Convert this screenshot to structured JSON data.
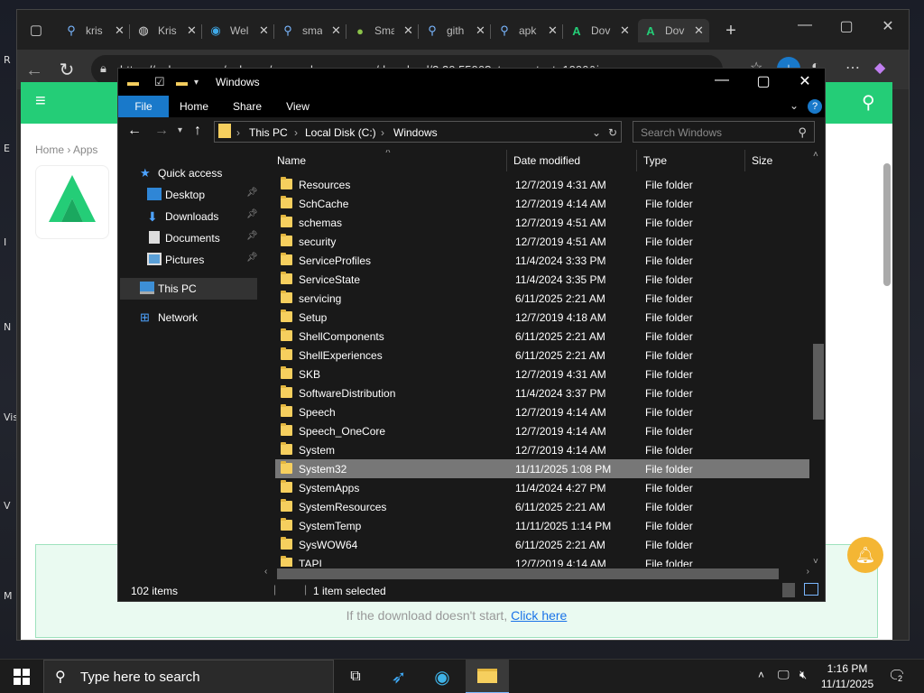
{
  "browser": {
    "tabs": [
      {
        "label": "kris",
        "icon": "search-icon"
      },
      {
        "label": "Kris",
        "icon": "globe-icon"
      },
      {
        "label": "Wel",
        "icon": "edge-icon"
      },
      {
        "label": "sma",
        "icon": "search-icon"
      },
      {
        "label": "Sma",
        "icon": "android-icon"
      },
      {
        "label": "gith",
        "icon": "search-icon"
      },
      {
        "label": "apk",
        "icon": "search-icon"
      },
      {
        "label": "Dov",
        "icon": "apkpure-icon"
      },
      {
        "label": "Dov",
        "icon": "apkpure-icon"
      }
    ],
    "url": "https://apkpure.com/apkpure/com.apkpure.aegon/download/3.20.5506?utm_content=1006&icn..."
  },
  "page": {
    "breadcrumb_home": "Home",
    "breadcrumb_apps": "Apps",
    "download_hint": "If the download doesn't start,",
    "download_link": "Click here"
  },
  "explorer": {
    "title": "Windows",
    "ribbon": {
      "file": "File",
      "home": "Home",
      "share": "Share",
      "view": "View"
    },
    "address": {
      "this_pc": "This PC",
      "local_disk": "Local Disk (C:)",
      "windows": "Windows"
    },
    "search_placeholder": "Search Windows",
    "nav": {
      "quick_access": "Quick access",
      "desktop": "Desktop",
      "downloads": "Downloads",
      "documents": "Documents",
      "pictures": "Pictures",
      "this_pc": "This PC",
      "network": "Network"
    },
    "columns": {
      "name": "Name",
      "date": "Date modified",
      "type": "Type",
      "size": "Size"
    },
    "files": [
      {
        "name": "Resources",
        "date": "12/7/2019 4:31 AM",
        "type": "File folder"
      },
      {
        "name": "SchCache",
        "date": "12/7/2019 4:14 AM",
        "type": "File folder"
      },
      {
        "name": "schemas",
        "date": "12/7/2019 4:51 AM",
        "type": "File folder"
      },
      {
        "name": "security",
        "date": "12/7/2019 4:51 AM",
        "type": "File folder"
      },
      {
        "name": "ServiceProfiles",
        "date": "11/4/2024 3:33 PM",
        "type": "File folder"
      },
      {
        "name": "ServiceState",
        "date": "11/4/2024 3:35 PM",
        "type": "File folder"
      },
      {
        "name": "servicing",
        "date": "6/11/2025 2:21 AM",
        "type": "File folder"
      },
      {
        "name": "Setup",
        "date": "12/7/2019 4:18 AM",
        "type": "File folder"
      },
      {
        "name": "ShellComponents",
        "date": "6/11/2025 2:21 AM",
        "type": "File folder"
      },
      {
        "name": "ShellExperiences",
        "date": "6/11/2025 2:21 AM",
        "type": "File folder"
      },
      {
        "name": "SKB",
        "date": "12/7/2019 4:31 AM",
        "type": "File folder"
      },
      {
        "name": "SoftwareDistribution",
        "date": "11/4/2024 3:37 PM",
        "type": "File folder"
      },
      {
        "name": "Speech",
        "date": "12/7/2019 4:14 AM",
        "type": "File folder"
      },
      {
        "name": "Speech_OneCore",
        "date": "12/7/2019 4:14 AM",
        "type": "File folder"
      },
      {
        "name": "System",
        "date": "12/7/2019 4:14 AM",
        "type": "File folder"
      },
      {
        "name": "System32",
        "date": "11/11/2025 1:08 PM",
        "type": "File folder",
        "selected": true
      },
      {
        "name": "SystemApps",
        "date": "11/4/2024 4:27 PM",
        "type": "File folder"
      },
      {
        "name": "SystemResources",
        "date": "6/11/2025 2:21 AM",
        "type": "File folder"
      },
      {
        "name": "SystemTemp",
        "date": "11/11/2025 1:14 PM",
        "type": "File folder"
      },
      {
        "name": "SysWOW64",
        "date": "6/11/2025 2:21 AM",
        "type": "File folder"
      },
      {
        "name": "TAPI",
        "date": "12/7/2019 4:14 AM",
        "type": "File folder"
      }
    ],
    "status": {
      "items": "102 items",
      "selected": "1 item selected"
    }
  },
  "taskbar": {
    "search_placeholder": "Type here to search",
    "time": "1:16 PM",
    "date": "11/11/2025",
    "notifications": "2"
  },
  "desktop_labels": [
    "R",
    "E",
    "I",
    "N",
    "Vis",
    "V",
    "M"
  ],
  "colors": {
    "explorer_bg": "#191919",
    "ribbon_file": "#1979ca",
    "apkpure_green": "#24cd77",
    "folder": "#f6cf5e",
    "selection": "#777777"
  }
}
